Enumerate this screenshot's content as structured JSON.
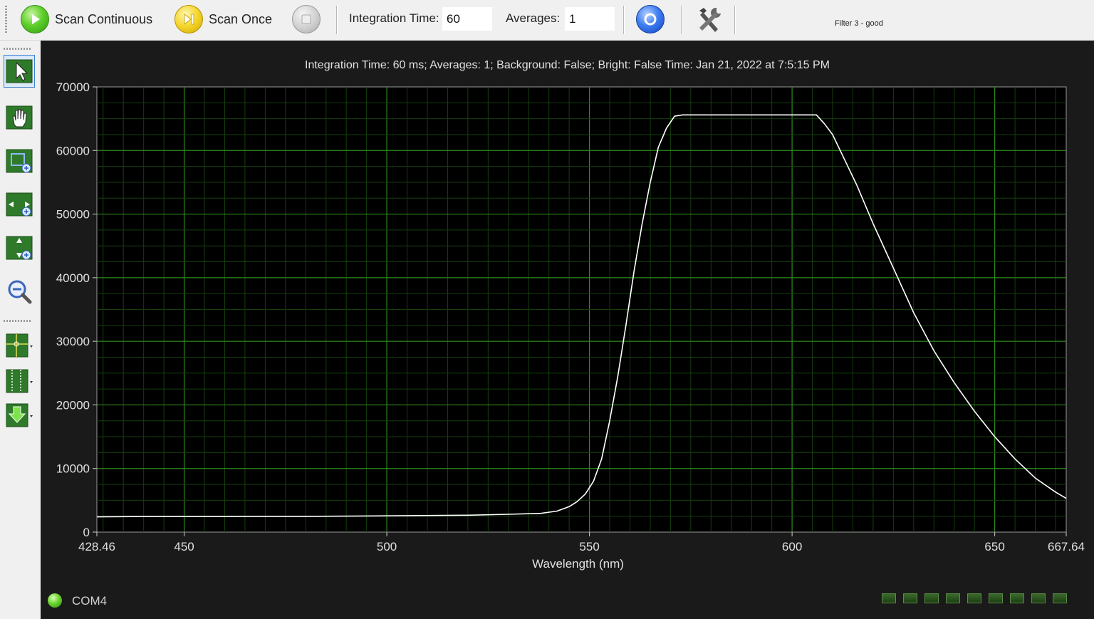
{
  "toolbar": {
    "scan_continuous": "Scan Continuous",
    "scan_once": "Scan Once",
    "integration_label": "Integration Time:",
    "integration_value": "60",
    "averages_label": "Averages:",
    "averages_value": "1",
    "filter_label": "Filter 3 - good"
  },
  "left_tools": [
    {
      "name": "pointer-tool-icon"
    },
    {
      "name": "pan-tool-icon"
    },
    {
      "name": "zoom-box-tool-icon"
    },
    {
      "name": "zoom-horizontal-tool-icon"
    },
    {
      "name": "zoom-vertical-tool-icon"
    },
    {
      "name": "zoom-out-tool-icon"
    },
    {
      "name": "crosshair-tool-icon"
    },
    {
      "name": "cursor-tool-icon"
    },
    {
      "name": "export-tool-icon"
    }
  ],
  "status": {
    "port": "COM4",
    "indicator_count": 9
  },
  "colors": {
    "plot_bg": "#000000",
    "grid": "#1f6a14",
    "trace": "#ffffff",
    "panel_bg": "#1a1a1a"
  },
  "chart_data": {
    "type": "line",
    "title": "Integration Time: 60 ms; Averages: 1; Background: False; Bright: False Time: Jan 21, 2022 at 7:5:15 PM",
    "xlabel": "Wavelength (nm)",
    "ylabel": "",
    "xlim": [
      428.46,
      667.64
    ],
    "ylim": [
      0,
      70000
    ],
    "x_ticks": [
      "428.46",
      "450",
      "500",
      "550",
      "600",
      "650",
      "667.64"
    ],
    "y_ticks": [
      "0",
      "10000",
      "20000",
      "30000",
      "40000",
      "50000",
      "60000",
      "70000"
    ],
    "grid": true,
    "series": [
      {
        "x": [
          428.46,
          440,
          460,
          480,
          500,
          520,
          530,
          538,
          542,
          545,
          547,
          549,
          551,
          553,
          555,
          557,
          559,
          561,
          563,
          565,
          567,
          569,
          571,
          573,
          575,
          580,
          590,
          600,
          606,
          608,
          610,
          613,
          616,
          620,
          625,
          630,
          635,
          640,
          645,
          650,
          655,
          660,
          665,
          667.64
        ],
        "values": [
          2400,
          2450,
          2450,
          2480,
          2550,
          2650,
          2800,
          2950,
          3300,
          4000,
          4800,
          6000,
          8000,
          11500,
          17500,
          24500,
          32500,
          41000,
          48500,
          55000,
          60500,
          63500,
          65400,
          65600,
          65600,
          65600,
          65600,
          65600,
          65600,
          64200,
          62500,
          58500,
          54500,
          48500,
          41500,
          34500,
          28500,
          23500,
          19000,
          15000,
          11500,
          8500,
          6300,
          5300
        ]
      }
    ]
  }
}
